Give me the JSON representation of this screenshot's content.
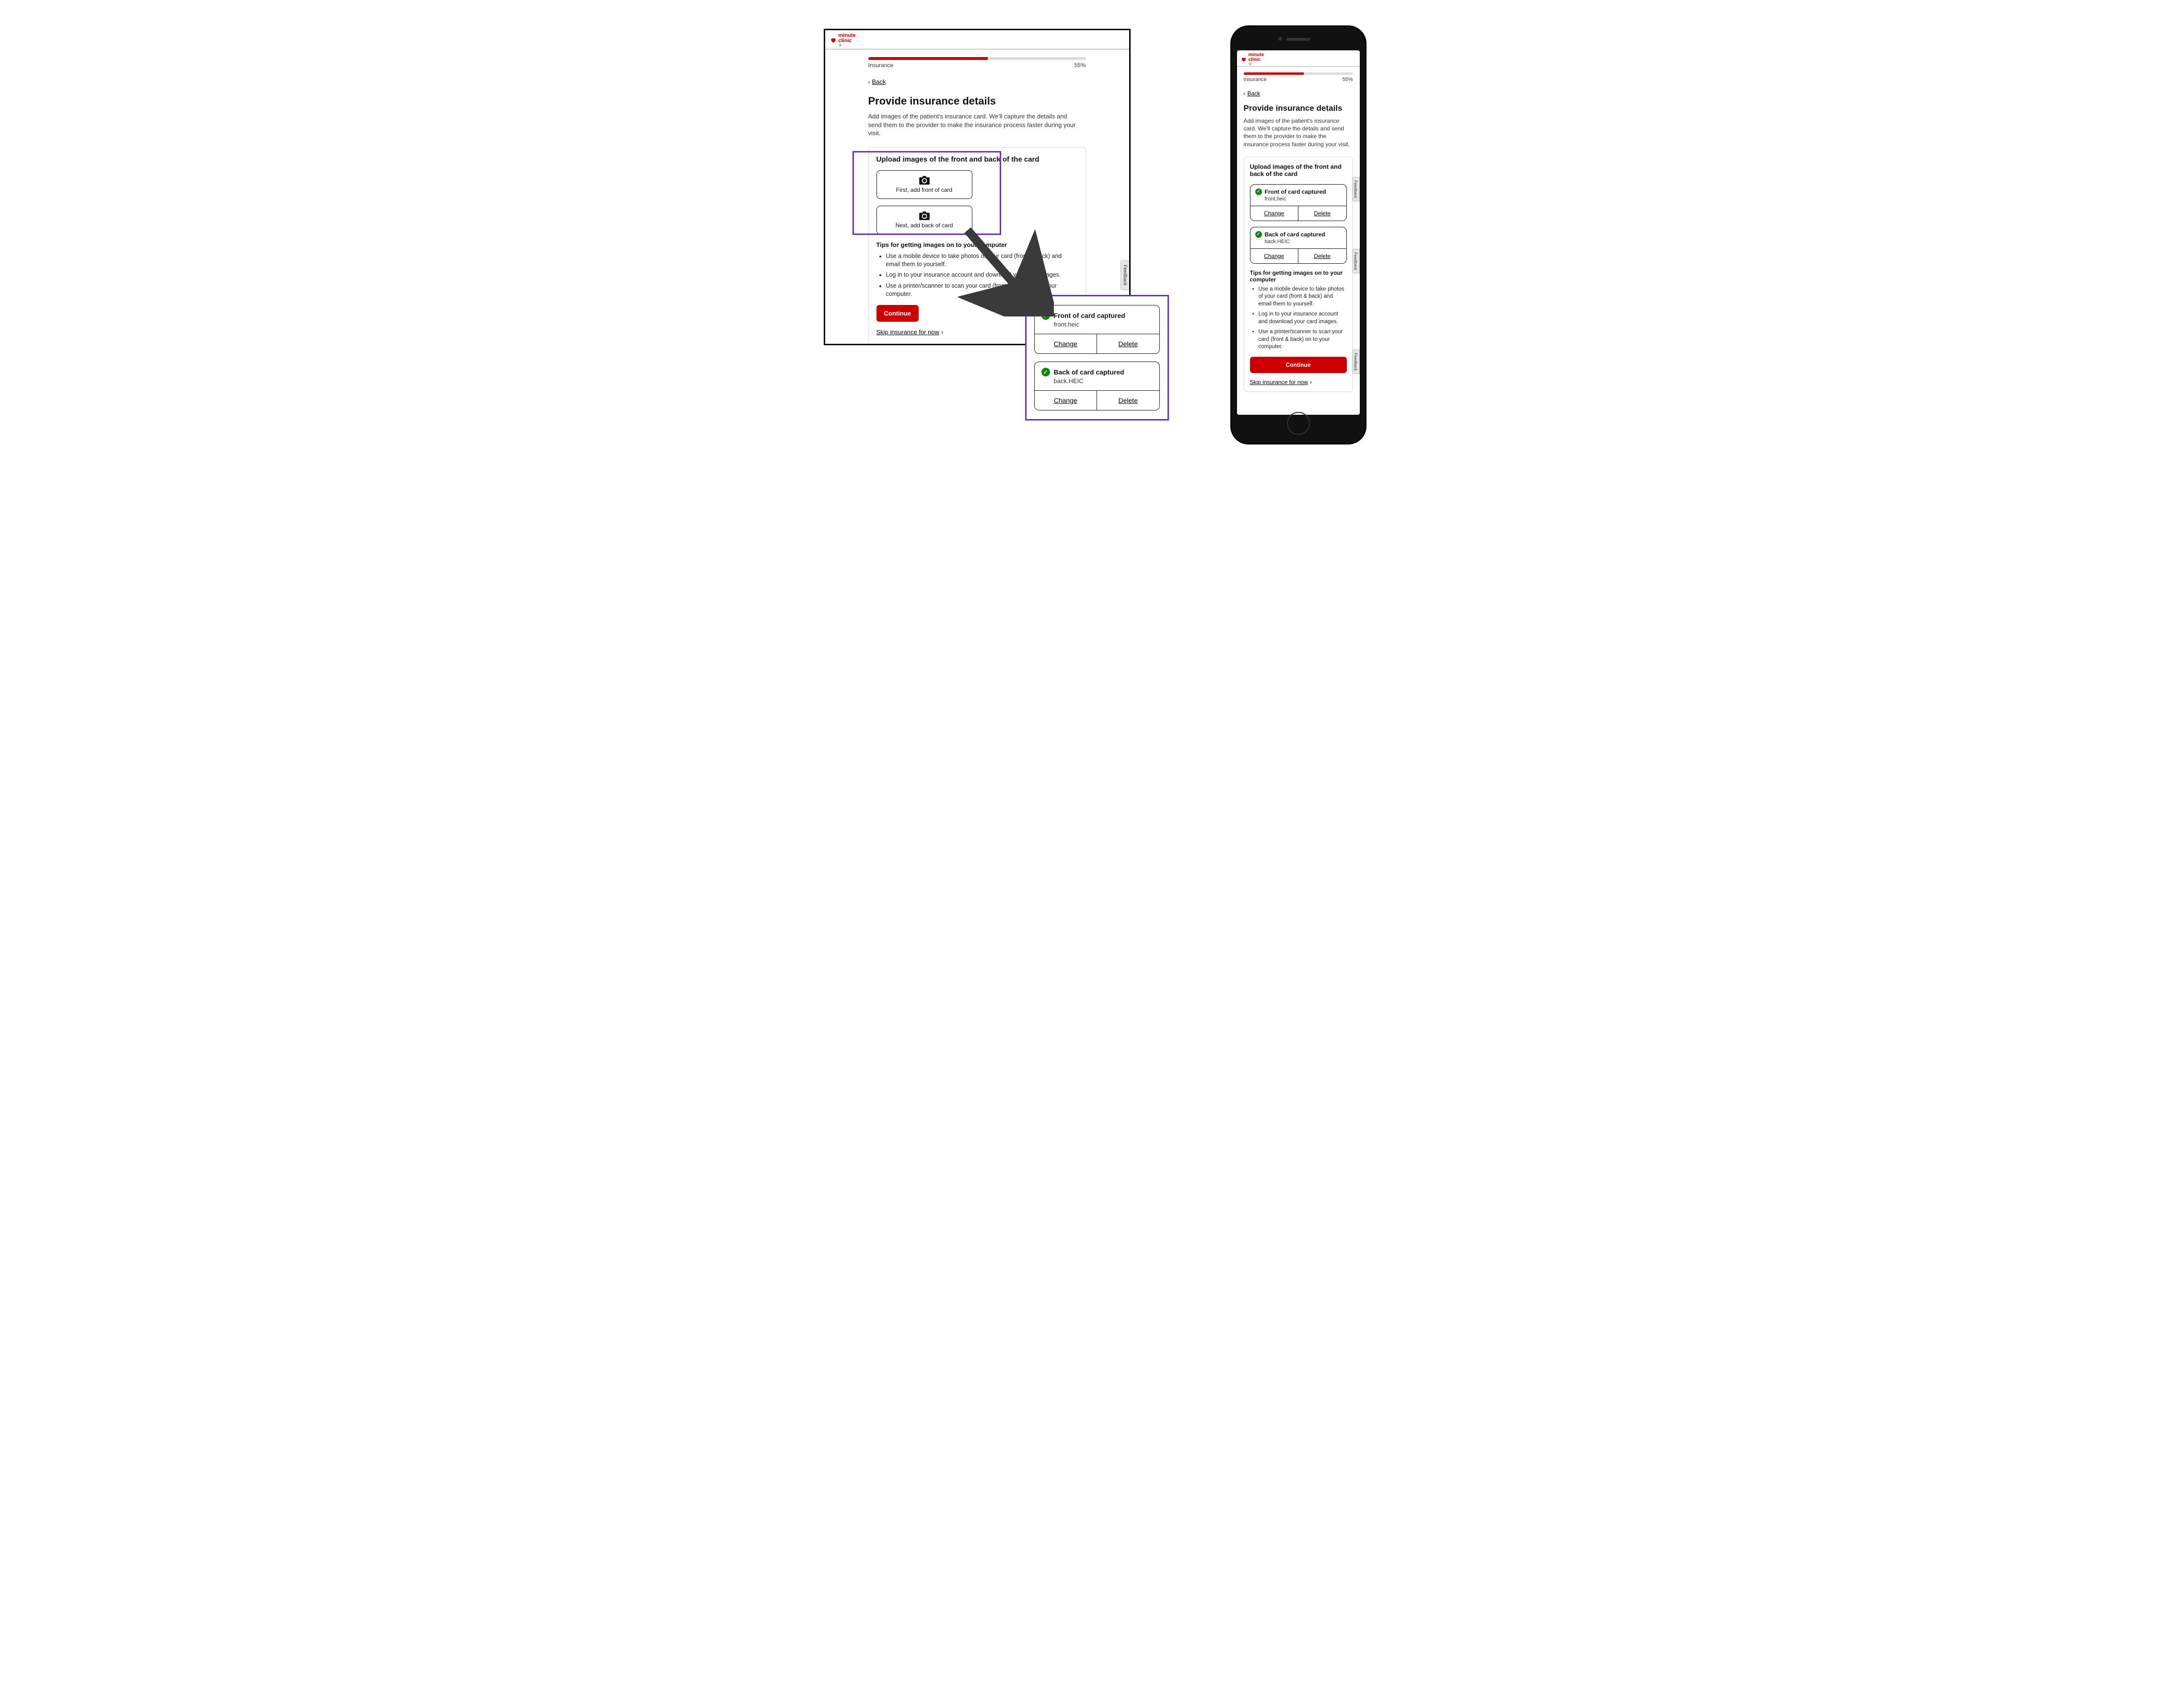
{
  "brand": {
    "line1": "minute",
    "line2": "clinic"
  },
  "progress": {
    "label": "Insurance",
    "percent_text": "55%",
    "percent": 55
  },
  "back": "Back",
  "title": "Provide insurance details",
  "desc": "Add images of the patient's insurance card. We'll capture the details and send them to the provider to make the insurance process faster during your visit.",
  "upload": {
    "heading": "Upload images of the front and back of the card",
    "front_prompt": "First, add front of card",
    "back_prompt": "Next, add back of card"
  },
  "captured": {
    "front": {
      "title": "Front of card captured",
      "file": "front.heic"
    },
    "back": {
      "title": "Back of card captured",
      "file": "back.HEIC"
    },
    "change": "Change",
    "delete": "Delete"
  },
  "tips": {
    "heading": "Tips for getting images on to your computer",
    "items": [
      "Use a mobile device to take photos of your card (front & back) and email them to yourself.",
      "Log in to your insurance account and download your card images.",
      "Use a printer/scanner to scan your card (front & back) on to your computer."
    ]
  },
  "continue": "Continue",
  "skip": "Skip insurance for now",
  "feedback": "Feedback",
  "colors": {
    "brand": "#cc0000",
    "annotation": "#6b2fc9",
    "success": "#0a8a0a"
  }
}
